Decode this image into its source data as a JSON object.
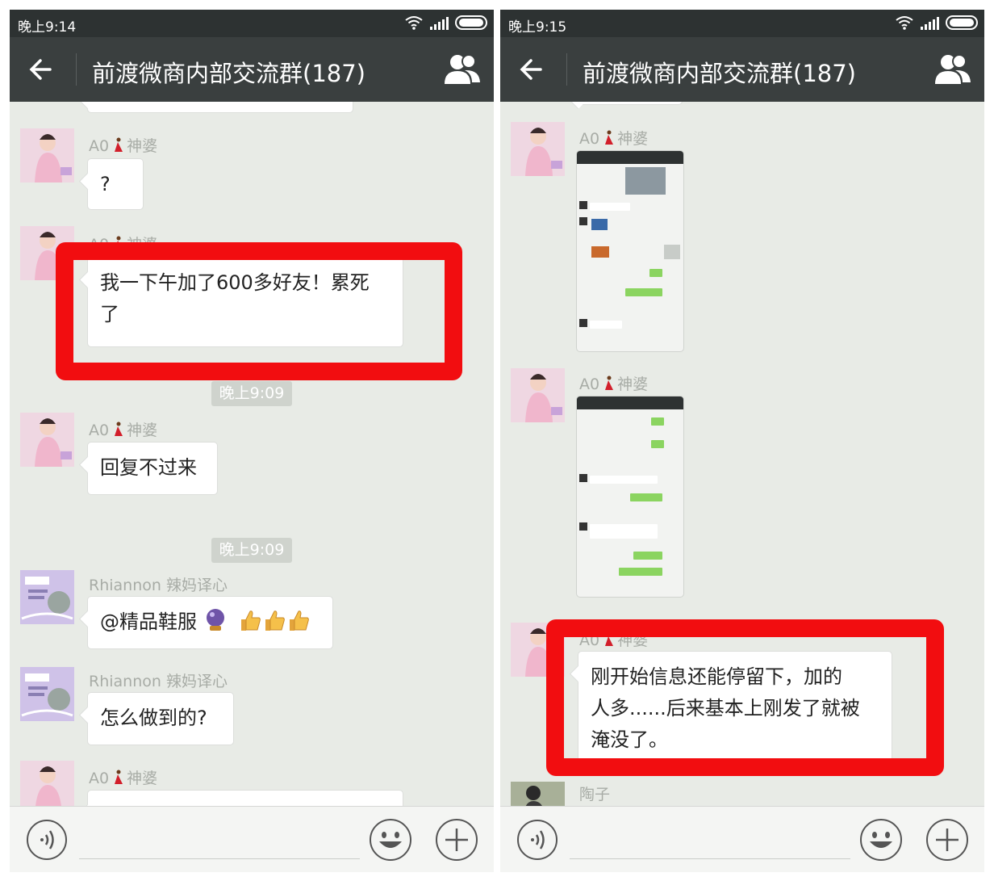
{
  "left_phone": {
    "status_time": "晚上9:14",
    "title": "前渡微商内部交流群(187)",
    "messages": [
      {
        "sender_prefix": "A0",
        "sender_name": "神婆",
        "text": "?"
      },
      {
        "sender_prefix": "A0",
        "sender_name": "神婆",
        "line1": "我一下午加了600多好友！累死",
        "line2": "了"
      },
      {
        "sender_prefix": "A0",
        "sender_name": "神婆",
        "text": "回复不过来"
      },
      {
        "sender_name": "Rhiannon  辣妈译心",
        "text": "@精品鞋服"
      },
      {
        "sender_name": "Rhiannon  辣妈译心",
        "text": "怎么做到的?"
      },
      {
        "sender_prefix": "A0",
        "sender_name": "神婆"
      }
    ],
    "timestamps": [
      "晚上9:09",
      "晚上9:09"
    ]
  },
  "right_phone": {
    "status_time": "晚上9:15",
    "title": "前渡微商内部交流群(187)",
    "messages": [
      {
        "sender_prefix": "A0",
        "sender_name": "神婆"
      },
      {
        "sender_prefix": "A0",
        "sender_name": "神婆"
      },
      {
        "sender_prefix": "A0",
        "sender_name": "神婆",
        "line1": "刚开始信息还能停留下，加的",
        "line2": "人多......后来基本上刚发了就被",
        "line3": "淹没了。"
      },
      {
        "sender_name": "陶子"
      }
    ]
  },
  "icons": [
    "back-arrow-icon",
    "group-members-icon",
    "voice-icon",
    "emoji-icon",
    "plus-icon",
    "wifi-icon",
    "signal-icon",
    "battery-icon",
    "crystal-ball-icon",
    "thumbs-up-icon",
    "dancer-emoji-icon"
  ],
  "colors": {
    "titlebar": "#3a3f3f",
    "chat_bg": "#e8ebe6",
    "highlight": "#f20d10",
    "bubble": "#ffffff",
    "wechat_green": "#8bd460"
  }
}
